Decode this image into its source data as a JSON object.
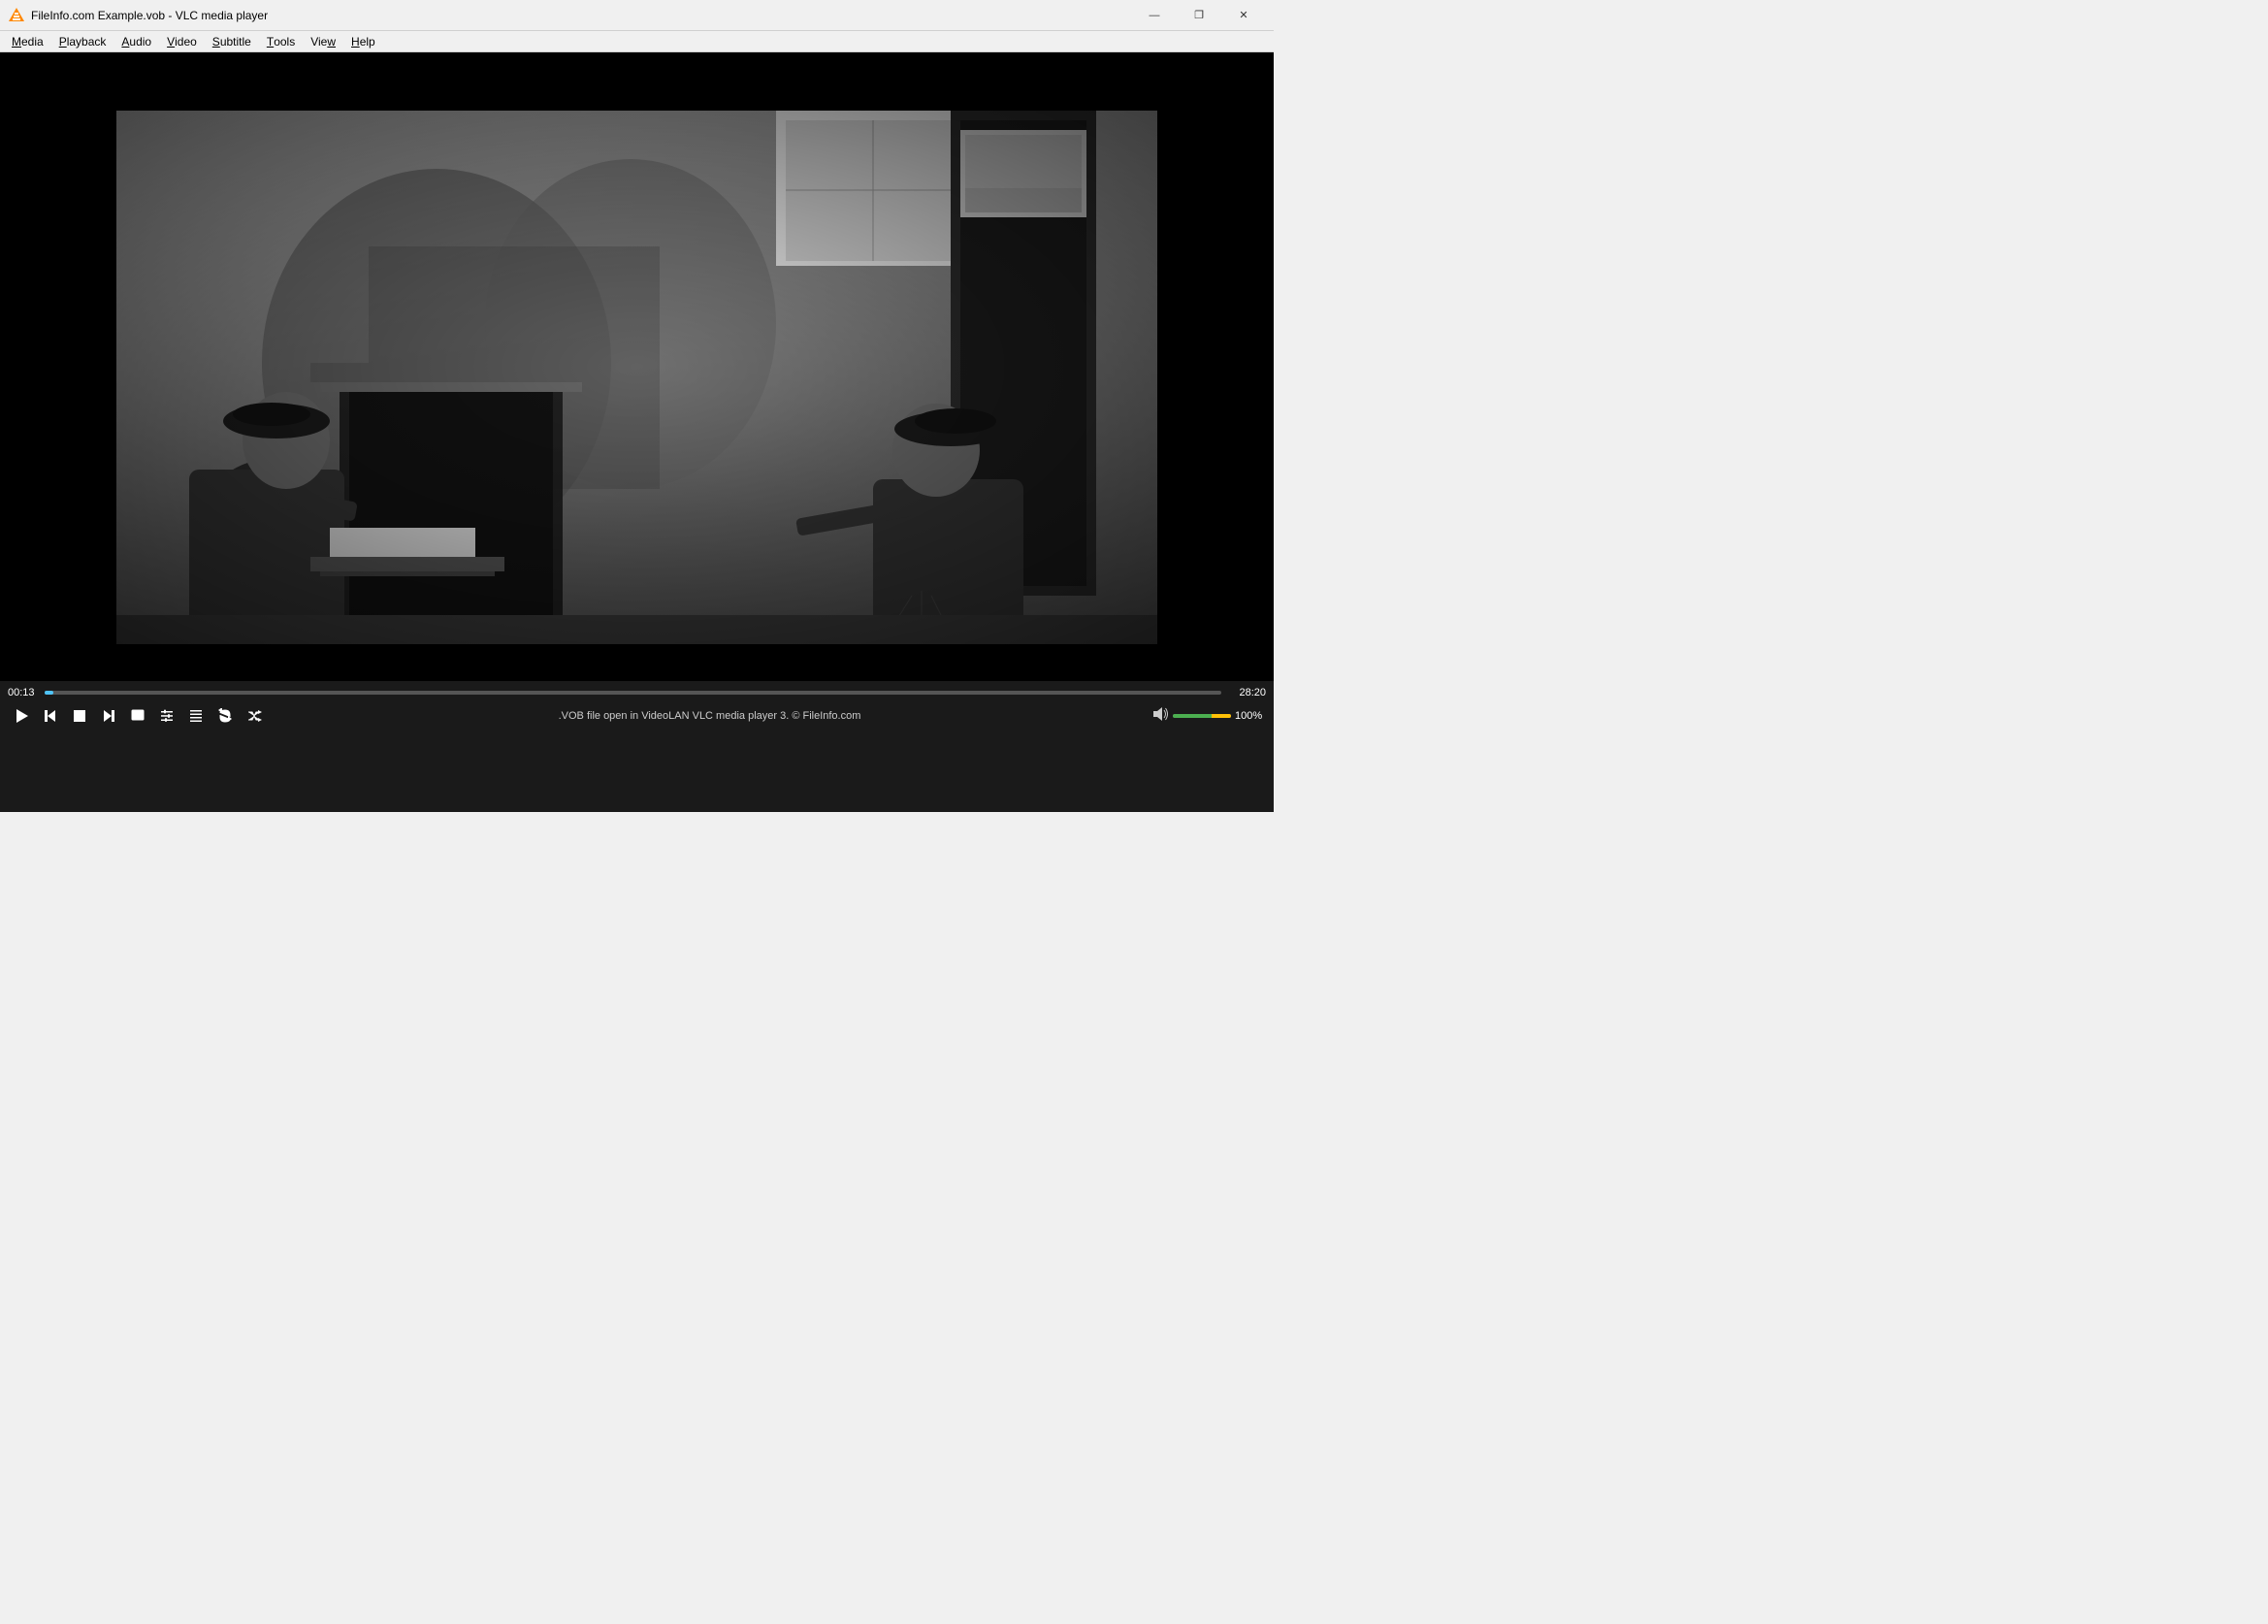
{
  "window": {
    "title": "FileInfo.com Example.vob - VLC media player",
    "icon": "vlc-icon"
  },
  "titlebar_controls": {
    "minimize": "—",
    "maximize": "❐",
    "close": "✕"
  },
  "menubar": {
    "items": [
      {
        "label": "Media",
        "underline_index": 0
      },
      {
        "label": "Playback",
        "underline_index": 0
      },
      {
        "label": "Audio",
        "underline_index": 0
      },
      {
        "label": "Video",
        "underline_index": 0
      },
      {
        "label": "Subtitle",
        "underline_index": 0
      },
      {
        "label": "Tools",
        "underline_index": 0
      },
      {
        "label": "View",
        "underline_index": 0
      },
      {
        "label": "Help",
        "underline_index": 0
      }
    ]
  },
  "player": {
    "time_current": "00:13",
    "time_total": "28:20",
    "progress_pct": 0.76,
    "status_text": ".VOB file open in VideoLAN VLC media player 3.  © FileInfo.com",
    "volume_pct": "100%",
    "volume_value": 100
  }
}
